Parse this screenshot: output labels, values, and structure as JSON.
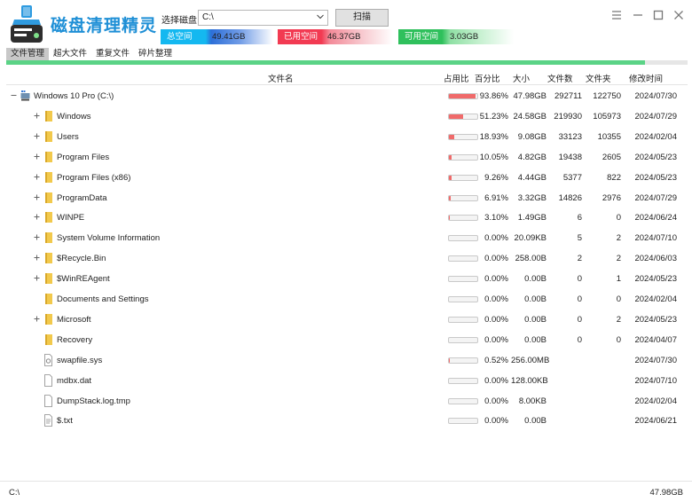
{
  "app": {
    "title": "磁盘清理精灵"
  },
  "toolbar": {
    "select_label": "选择磁盘：",
    "drive_value": "C:\\",
    "scan_label": "扫描"
  },
  "stats": {
    "total": {
      "label": "总空间",
      "value": "49.41GB"
    },
    "used": {
      "label": "已用空间",
      "value": "46.37GB"
    },
    "free": {
      "label": "可用空间",
      "value": "3.03GB"
    }
  },
  "tabs": [
    "文件管理",
    "超大文件",
    "重复文件",
    "碎片整理"
  ],
  "progress": {
    "value": 0.938
  },
  "columns": {
    "name": "文件名",
    "usage": "占用比",
    "percent": "百分比",
    "size": "大小",
    "files": "文件数",
    "dirs": "文件夹",
    "modified": "修改时间"
  },
  "rows": [
    {
      "name": "Windows 10 Pro (C:\\)",
      "type": "drive",
      "level": 0,
      "expand": "minus",
      "ratio": 0.9386,
      "percent": "93.86%",
      "size": "47.98GB",
      "files": "292711",
      "dirs": "122750",
      "date": "2024/07/30"
    },
    {
      "name": "Windows",
      "type": "folder",
      "level": 1,
      "expand": "plus",
      "ratio": 0.5123,
      "percent": "51.23%",
      "size": "24.58GB",
      "files": "219930",
      "dirs": "105973",
      "date": "2024/07/29"
    },
    {
      "name": "Users",
      "type": "folder",
      "level": 1,
      "expand": "plus",
      "ratio": 0.1893,
      "percent": "18.93%",
      "size": "9.08GB",
      "files": "33123",
      "dirs": "10355",
      "date": "2024/02/04"
    },
    {
      "name": "Program Files",
      "type": "folder",
      "level": 1,
      "expand": "plus",
      "ratio": 0.1005,
      "percent": "10.05%",
      "size": "4.82GB",
      "files": "19438",
      "dirs": "2605",
      "date": "2024/05/23"
    },
    {
      "name": "Program Files (x86)",
      "type": "folder",
      "level": 1,
      "expand": "plus",
      "ratio": 0.0926,
      "percent": "9.26%",
      "size": "4.44GB",
      "files": "5377",
      "dirs": "822",
      "date": "2024/05/23"
    },
    {
      "name": "ProgramData",
      "type": "folder",
      "level": 1,
      "expand": "plus",
      "ratio": 0.0691,
      "percent": "6.91%",
      "size": "3.32GB",
      "files": "14826",
      "dirs": "2976",
      "date": "2024/07/29"
    },
    {
      "name": "WINPE",
      "type": "folder",
      "level": 1,
      "expand": "plus",
      "ratio": 0.031,
      "percent": "3.10%",
      "size": "1.49GB",
      "files": "6",
      "dirs": "0",
      "date": "2024/06/24"
    },
    {
      "name": "System Volume Information",
      "type": "folder",
      "level": 1,
      "expand": "plus",
      "ratio": 0,
      "percent": "0.00%",
      "size": "20.09KB",
      "files": "5",
      "dirs": "2",
      "date": "2024/07/10"
    },
    {
      "name": "$Recycle.Bin",
      "type": "folder",
      "level": 1,
      "expand": "plus",
      "ratio": 0,
      "percent": "0.00%",
      "size": "258.00B",
      "files": "2",
      "dirs": "2",
      "date": "2024/06/03"
    },
    {
      "name": "$WinREAgent",
      "type": "folder",
      "level": 1,
      "expand": "plus",
      "ratio": 0,
      "percent": "0.00%",
      "size": "0.00B",
      "files": "0",
      "dirs": "1",
      "date": "2024/05/23"
    },
    {
      "name": "Documents and Settings",
      "type": "folder",
      "level": 1,
      "expand": "none",
      "ratio": 0,
      "percent": "0.00%",
      "size": "0.00B",
      "files": "0",
      "dirs": "0",
      "date": "2024/02/04"
    },
    {
      "name": "Microsoft",
      "type": "folder",
      "level": 1,
      "expand": "plus",
      "ratio": 0,
      "percent": "0.00%",
      "size": "0.00B",
      "files": "0",
      "dirs": "2",
      "date": "2024/05/23"
    },
    {
      "name": "Recovery",
      "type": "folder",
      "level": 1,
      "expand": "none",
      "ratio": 0,
      "percent": "0.00%",
      "size": "0.00B",
      "files": "0",
      "dirs": "0",
      "date": "2024/04/07"
    },
    {
      "name": "swapfile.sys",
      "type": "sysfile",
      "level": 1,
      "expand": "none",
      "ratio": 0.0052,
      "percent": "0.52%",
      "size": "256.00MB",
      "files": "",
      "dirs": "",
      "date": "2024/07/30"
    },
    {
      "name": "mdbx.dat",
      "type": "file",
      "level": 1,
      "expand": "none",
      "ratio": 0,
      "percent": "0.00%",
      "size": "128.00KB",
      "files": "",
      "dirs": "",
      "date": "2024/07/10"
    },
    {
      "name": "DumpStack.log.tmp",
      "type": "file",
      "level": 1,
      "expand": "none",
      "ratio": 0,
      "percent": "0.00%",
      "size": "8.00KB",
      "files": "",
      "dirs": "",
      "date": "2024/02/04"
    },
    {
      "name": "$.txt",
      "type": "textfile",
      "level": 1,
      "expand": "none",
      "ratio": 0,
      "percent": "0.00%",
      "size": "0.00B",
      "files": "",
      "dirs": "",
      "date": "2024/06/21"
    }
  ],
  "status": {
    "left": "C:\\",
    "right": "47.98GB"
  },
  "colors": {
    "accent": "#1e8fd6",
    "progress": "#5bd386",
    "bar_fill": "#f06a6a",
    "folder": "#f2c94c"
  },
  "icons": {
    "logo": "broom-disk-icon",
    "minimize": "minimize-icon",
    "maximize": "maximize-icon",
    "close": "close-icon",
    "menu": "menu-icon"
  }
}
